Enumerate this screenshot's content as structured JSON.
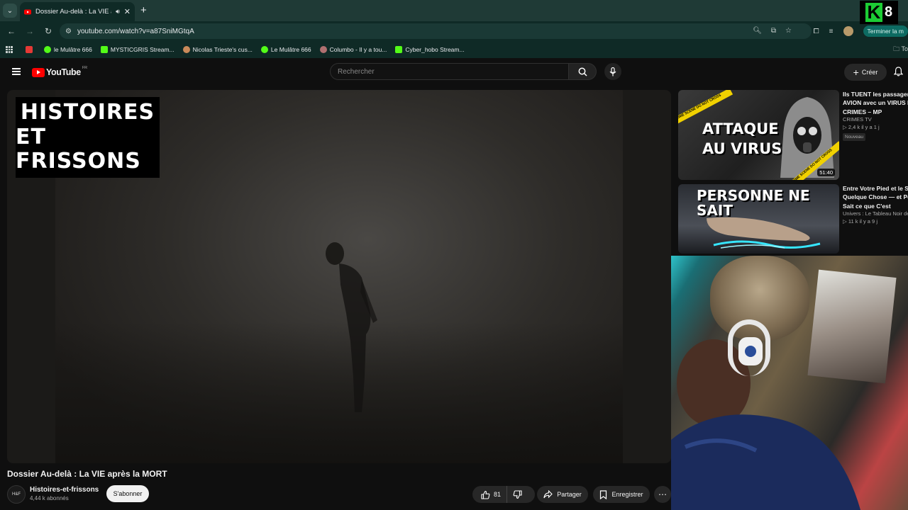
{
  "browser": {
    "tab": {
      "title": "Dossier Au-delà : La VIE après la MORT"
    },
    "url": "youtube.com/watch?v=a87SniMGtqA",
    "finish_label": "Terminer la m",
    "bookmarks": [
      {
        "label": "",
        "color": "#e53935"
      },
      {
        "label": "le Mulâtre 666",
        "color": "#53fc18"
      },
      {
        "label": "MYSTICGRIS Stream...",
        "color": "#53fc18"
      },
      {
        "label": "Nicolas Trieste's cus...",
        "color": "#c98a5a"
      },
      {
        "label": "Le Mulâtre 666",
        "color": "#53fc18"
      },
      {
        "label": "Columbo - Il y a tou...",
        "color": "#b07070"
      },
      {
        "label": "Cyber_hobo Stream...",
        "color": "#53fc18"
      }
    ],
    "bookmarks_folder": "To"
  },
  "overlay": {
    "k_letter": "K",
    "number": "8"
  },
  "youtube": {
    "logo_text": "YouTube",
    "country": "FR",
    "search_placeholder": "Rechercher",
    "create_label": "Créer"
  },
  "video": {
    "title": "Dossier Au-delà : La VIE après la MORT",
    "overlay_line1": "HISTOIRES",
    "overlay_line2": "ET FRISSONS"
  },
  "channel": {
    "name": "Histoires-et-frissons",
    "subs": "4,44 k abonnés",
    "avatar_text": "H&F",
    "subscribe_label": "S'abonner"
  },
  "actions": {
    "likes": "81",
    "share": "Partager",
    "save": "Enregistrer"
  },
  "sidebar": [
    {
      "thumb_text_1": "ATTAQUE",
      "thumb_text_2": "AU VIRUS",
      "tape": "CRIME SCENE DO NOT CROSS",
      "duration": "51:40",
      "title_1": "Ils TUENT les passagers",
      "title_2": "AVION avec un VIRUS M",
      "title_3": "CRIMES – MP",
      "channel": "CRIMES TV",
      "meta": "▷ 2,4 k  il y a 1 j",
      "badge": "Nouveau"
    },
    {
      "thumb_text_1": "PERSONNE NE SAIT",
      "title_1": "Entre Votre Pied et le So",
      "title_2": "Quelque Chose — et Per",
      "title_3": "Sait ce que C'est",
      "channel": "Univers : Le Tableau Noir de",
      "meta": "▷ 11 k  il y a 9 j"
    }
  ]
}
